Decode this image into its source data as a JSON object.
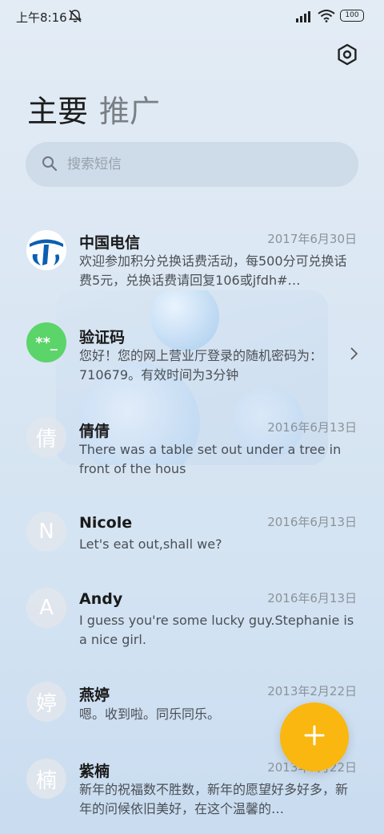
{
  "status_bar": {
    "time": "上午8:16",
    "battery": "100"
  },
  "header": {
    "tabs": [
      {
        "label": "主要",
        "active": true
      },
      {
        "label": "推广",
        "active": false
      }
    ],
    "settings_icon": "gear-hex-icon"
  },
  "search": {
    "placeholder": "搜索短信"
  },
  "messages": [
    {
      "sender": "中国电信",
      "date": "2017年6月30日",
      "preview": "欢迎参加积分兑换话费活动，每500分可兑换话费5元，兑换话费请回复106或jfdh#…",
      "avatar": "",
      "avatar_type": "china-telecom-logo"
    },
    {
      "sender": "验证码",
      "date": "",
      "preview": "您好！您的网上营业厅登录的随机密码为：710679。有效时间为3分钟",
      "avatar": "**_",
      "avatar_type": "code"
    },
    {
      "sender": "倩倩",
      "date": "2016年6月13日",
      "preview": "There was a table set out under a tree in front of the hous",
      "avatar": "倩",
      "avatar_type": "letter"
    },
    {
      "sender": "Nicole",
      "date": "2016年6月13日",
      "preview": "Let's eat out,shall we?",
      "avatar": "N",
      "avatar_type": "letter"
    },
    {
      "sender": "Andy",
      "date": "2016年6月13日",
      "preview": "I guess you're some lucky guy.Stephanie is a nice girl.",
      "avatar": "A",
      "avatar_type": "letter"
    },
    {
      "sender": "燕婷",
      "date": "2013年2月22日",
      "preview": "嗯。收到啦。同乐同乐。",
      "avatar": "婷",
      "avatar_type": "letter"
    },
    {
      "sender": "紫楠",
      "date": "2013年2月22日",
      "preview": "新年的祝福数不胜数，新年的愿望好多好多，新年的问候依旧美好，在这个温馨的…",
      "avatar": "楠",
      "avatar_type": "letter"
    }
  ],
  "fab": {
    "icon": "plus-icon",
    "color": "#f9b70f"
  },
  "colors": {
    "accent": "#f9b70f",
    "code_avatar": "#5bd46a",
    "telecom_blue": "#0b5fb0"
  }
}
